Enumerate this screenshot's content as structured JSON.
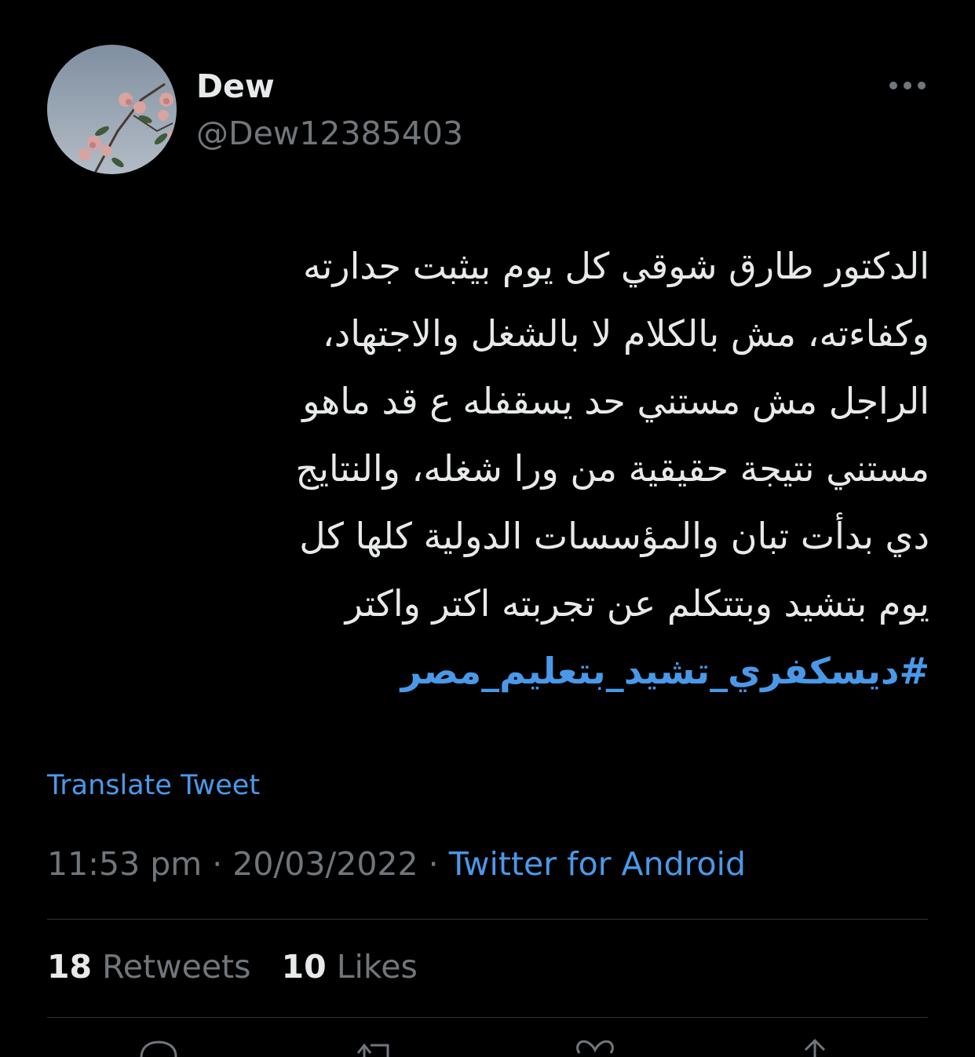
{
  "author": {
    "display_name": "Dew",
    "handle": "@Dew12385403"
  },
  "tweet": {
    "lines": [
      "الدكتور طارق شوقي كل يوم بيثبت جدارته",
      "وكفاءته، مش بالكلام لا بالشغل والاجتهاد،",
      "الراجل مش مستني حد يسقفله ع قد ماهو",
      "مستني نتيجة حقيقية من ورا شغله، والنتايج",
      "دي بدأت تبان والمؤسسات الدولية كلها كل",
      "يوم بتشيد وبتتكلم عن تجربته اكتر واكتر"
    ],
    "hashtag": "#ديسكفري_تشيد_بتعليم_مصر"
  },
  "translate_label": "Translate Tweet",
  "meta": {
    "time": "11:53 pm",
    "sep1": " · ",
    "date": "20/03/2022",
    "sep2": " · ",
    "source": "Twitter for Android"
  },
  "stats": {
    "retweets_count": "18",
    "retweets_label": "Retweets",
    "likes_count": "10",
    "likes_label": "Likes"
  },
  "icons": {
    "more": "more-horizontal-icon",
    "reply": "reply-icon",
    "retweet": "retweet-icon",
    "like": "heart-icon",
    "share": "share-icon"
  },
  "colors": {
    "background": "#000000",
    "text": "#e7e9ea",
    "secondary": "#71767b",
    "accent": "#4a99e9"
  }
}
